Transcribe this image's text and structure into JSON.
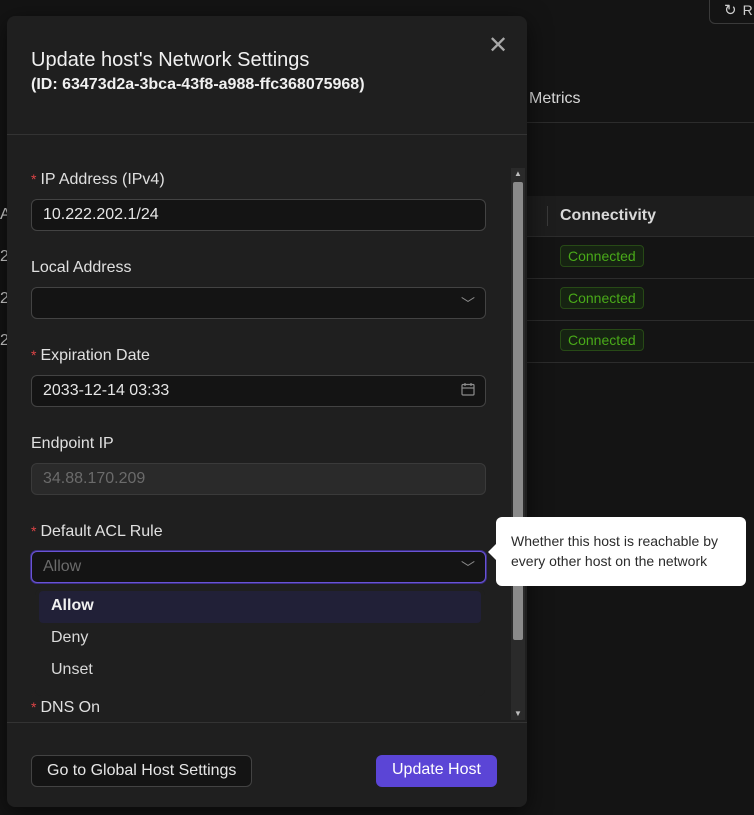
{
  "background": {
    "refresh_label": "R",
    "tab_metrics": "Metrics",
    "table": {
      "column_header": "Connectivity",
      "left_col_fragment": "A",
      "rows": [
        {
          "left_fragment": "2",
          "status": "Connected"
        },
        {
          "left_fragment": "2",
          "status": "Connected"
        },
        {
          "left_fragment": "2",
          "status": "Connected"
        }
      ]
    },
    "status_color": "#49aa19"
  },
  "modal": {
    "title": "Update host's Network Settings",
    "subtitle": "(ID: 63473d2a-3bca-43f8-a988-ffc368075968)",
    "fields": {
      "ip_address": {
        "label": "IP Address (IPv4)",
        "required": true,
        "value": "10.222.202.1/24"
      },
      "local_address": {
        "label": "Local Address",
        "required": false,
        "value": ""
      },
      "expiration_date": {
        "label": "Expiration Date",
        "required": true,
        "value": "2033-12-14 03:33"
      },
      "endpoint_ip": {
        "label": "Endpoint IP",
        "required": false,
        "value": "34.88.170.209"
      },
      "default_acl_rule": {
        "label": "Default ACL Rule",
        "required": true,
        "placeholder": "Allow",
        "options": [
          "Allow",
          "Deny",
          "Unset"
        ],
        "selected": "Allow"
      },
      "dns_on": {
        "label": "DNS On",
        "required": true
      }
    },
    "buttons": {
      "global_settings": "Go to Global Host Settings",
      "update": "Update Host"
    },
    "required_mark": "*"
  },
  "tooltip": {
    "text": "Whether this host is reachable by every other host on the network"
  },
  "colors": {
    "accent": "#5b45d6",
    "required": "#dc4446",
    "focus_border": "#6a54d4"
  },
  "icons": {
    "close": "close-icon",
    "chevron": "chevron-down-icon",
    "calendar": "calendar-icon",
    "refresh": "refresh-icon"
  }
}
